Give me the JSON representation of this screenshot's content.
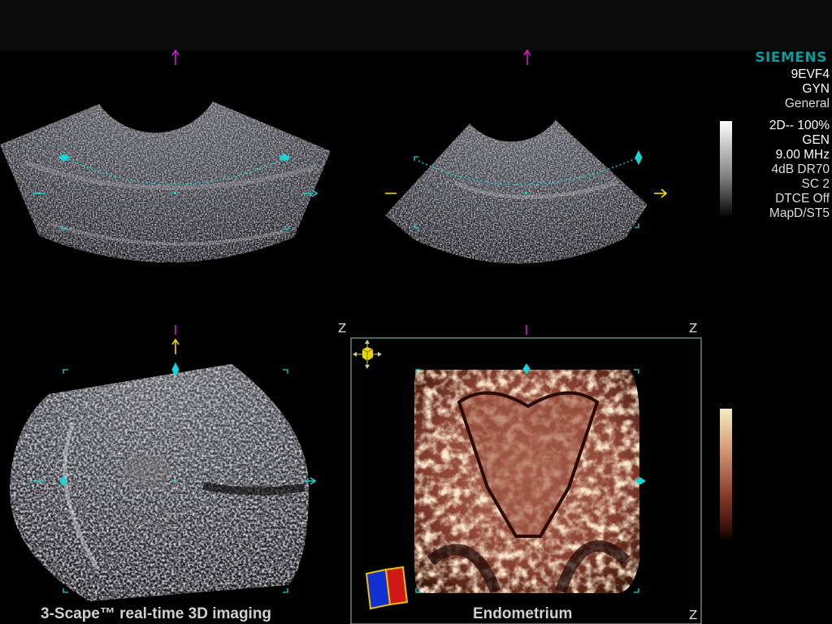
{
  "header": {
    "brand": "SIEMENS"
  },
  "transducer_panel": {
    "probe": "9EVF4",
    "exam": "GYN",
    "preset": "General"
  },
  "imaging_params": {
    "mode": "2D-- 100%",
    "gen": "GEN",
    "frequency": "9.00 MHz",
    "gain_dr": "4dB DR70",
    "sc": "SC 2",
    "dtce": "DTCE Off",
    "map": "MapD/ST5"
  },
  "views": {
    "caption_left": "3-Scape™ real-time 3D imaging",
    "caption_right": "Endometrium",
    "z_label": "Z"
  },
  "colors": {
    "cyan": "#19d6d6",
    "magenta": "#e01ee0",
    "yellow": "#ffe800",
    "frame": "#7fd3a8",
    "brand": "#0c9a9a"
  },
  "icons": {
    "rotate_cube": "cube-move-icon",
    "orientation_cube": "orientation-cube-icon"
  }
}
